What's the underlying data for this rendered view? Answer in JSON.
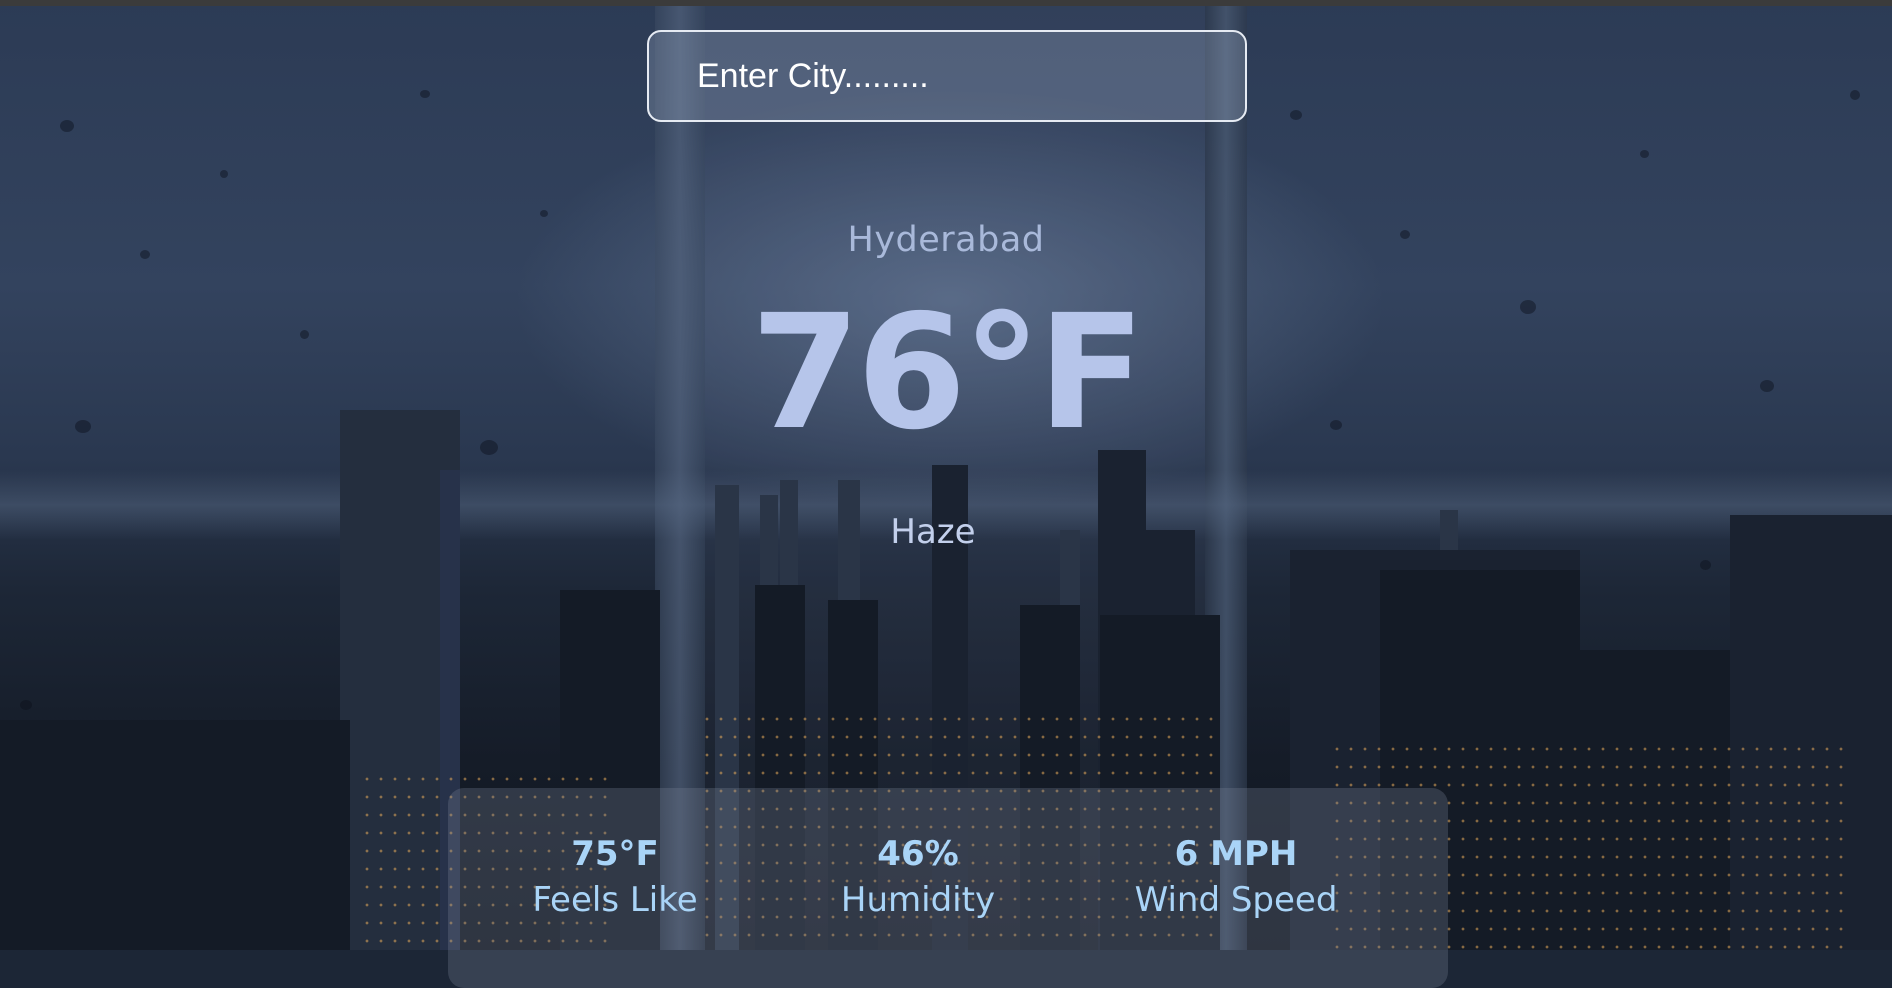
{
  "search": {
    "placeholder": "Enter City........."
  },
  "weather": {
    "city": "Hyderabad",
    "temperature": "76°F",
    "condition": "Haze"
  },
  "stats": [
    {
      "value": "75°F",
      "label": "Feels Like"
    },
    {
      "value": "46%",
      "label": "Humidity"
    },
    {
      "value": "6 MPH",
      "label": "Wind Speed"
    }
  ],
  "colors": {
    "text_primary": "#b6c5ea",
    "stat_accent": "#a9d4f7",
    "background": "#1c2636"
  }
}
